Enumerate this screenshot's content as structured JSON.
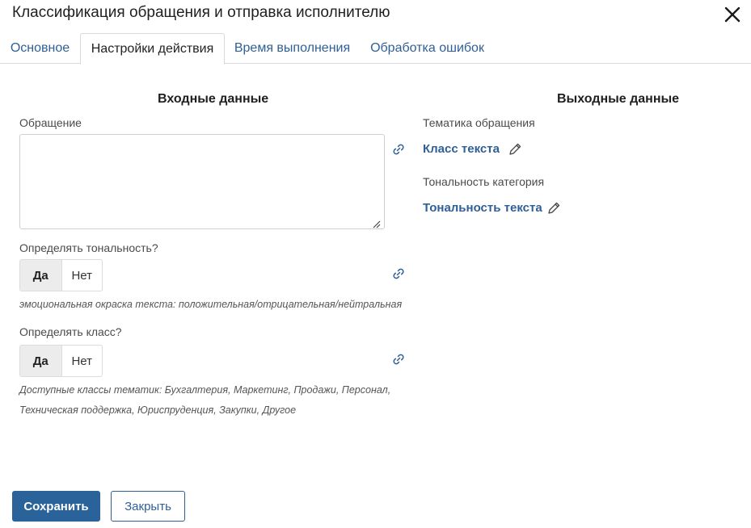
{
  "dialog": {
    "title": "Классификация обращения и отправка исполнителю"
  },
  "tabs": [
    {
      "label": "Основное",
      "active": false
    },
    {
      "label": "Настройки действия",
      "active": true
    },
    {
      "label": "Время выполнения",
      "active": false
    },
    {
      "label": "Обработка ошибок",
      "active": false
    }
  ],
  "input": {
    "title": "Входные данные",
    "request": {
      "label": "Обращение",
      "value": ""
    },
    "tone": {
      "label": "Определять тональность?",
      "options": [
        "Да",
        "Нет"
      ],
      "selected": "Да",
      "hint": "эмоциональная окраска текста: положительная/отрицательная/нейтральная"
    },
    "class": {
      "label": "Определять класс?",
      "options": [
        "Да",
        "Нет"
      ],
      "selected": "Да",
      "hint_line1": "Доступные классы тематик: Бухгалтерия, Маркетинг, Продажи, Персонал,",
      "hint_line2": "Техническая поддержка, Юриспруденция, Закупки, Другое"
    }
  },
  "output": {
    "title": "Выходные данные",
    "topic": {
      "label": "Тематика обращения",
      "value": "Класс текста"
    },
    "tonality": {
      "label": "Тональность категория",
      "value": "Тональность текста"
    }
  },
  "footer": {
    "save_label": "Сохранить",
    "close_label": "Закрыть"
  },
  "colors": {
    "accent": "#2a6399",
    "link": "#2f5f95"
  },
  "icons": {
    "close": "close-icon",
    "link": "link-icon",
    "edit": "pencil-icon"
  }
}
